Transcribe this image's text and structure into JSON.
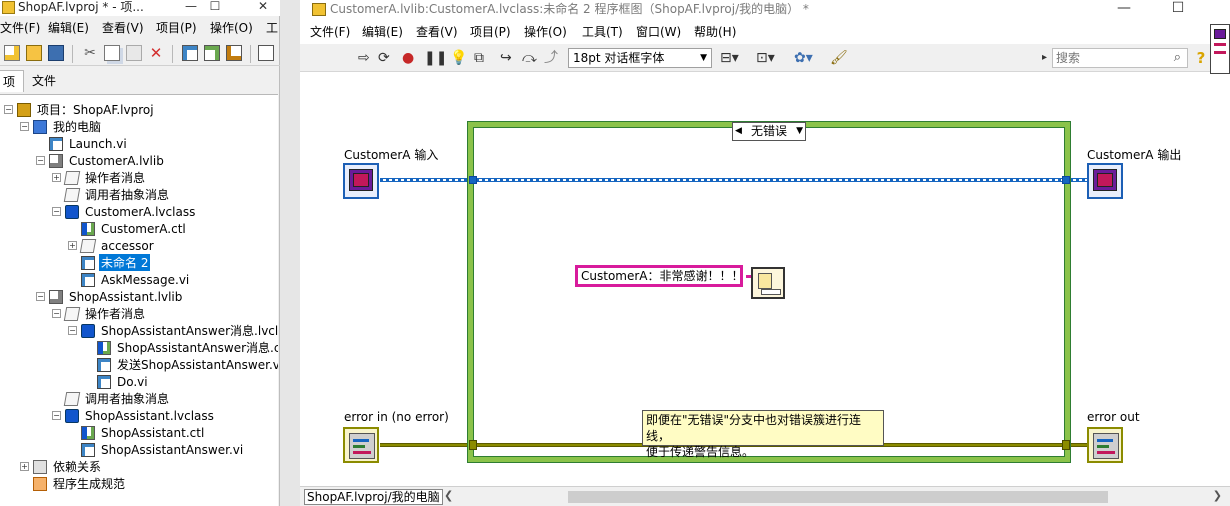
{
  "project_window": {
    "title": "ShopAF.lvproj * - 项...",
    "window_controls": {
      "minimize": "—",
      "maximize": "☐",
      "close": "✕"
    },
    "menu": [
      "文件(F)",
      "编辑(E)",
      "查看(V)",
      "项目(P)",
      "操作(O)",
      "工"
    ],
    "tabs": [
      "项",
      "文件"
    ],
    "tree": [
      {
        "label": "项目：ShopAF.lvproj",
        "icon": "project-icon",
        "level": 0,
        "toggle": "−"
      },
      {
        "label": "我的电脑",
        "icon": "computer-icon",
        "level": 1,
        "toggle": "−"
      },
      {
        "label": "Launch.vi",
        "icon": "vi-icon",
        "level": 2,
        "toggle": ""
      },
      {
        "label": "CustomerA.lvlib",
        "icon": "library-icon",
        "level": 2,
        "toggle": "−"
      },
      {
        "label": "操作者消息",
        "icon": "folder-icon",
        "level": 3,
        "toggle": "+"
      },
      {
        "label": "调用者抽象消息",
        "icon": "folder-icon",
        "level": 3,
        "toggle": ""
      },
      {
        "label": "CustomerA.lvclass",
        "icon": "class-icon",
        "level": 3,
        "toggle": "−"
      },
      {
        "label": "CustomerA.ctl",
        "icon": "control-icon",
        "level": 4,
        "toggle": ""
      },
      {
        "label": "accessor",
        "icon": "folder-icon",
        "level": 4,
        "toggle": "+"
      },
      {
        "label": "未命名 2",
        "icon": "vi-icon",
        "level": 4,
        "toggle": "",
        "selected": true
      },
      {
        "label": "AskMessage.vi",
        "icon": "vi-icon",
        "level": 4,
        "toggle": ""
      },
      {
        "label": "ShopAssistant.lvlib",
        "icon": "library-icon",
        "level": 2,
        "toggle": "−"
      },
      {
        "label": "操作者消息",
        "icon": "folder-icon",
        "level": 3,
        "toggle": "−"
      },
      {
        "label": "ShopAssistantAnswer消息.lvcl",
        "icon": "class-icon",
        "level": 4,
        "toggle": "−"
      },
      {
        "label": "ShopAssistantAnswer消息.c",
        "icon": "control-icon",
        "level": 5,
        "toggle": ""
      },
      {
        "label": "发送ShopAssistantAnswer.v",
        "icon": "vi-icon",
        "level": 5,
        "toggle": ""
      },
      {
        "label": "Do.vi",
        "icon": "vi-icon",
        "level": 5,
        "toggle": ""
      },
      {
        "label": "调用者抽象消息",
        "icon": "folder-icon",
        "level": 3,
        "toggle": ""
      },
      {
        "label": "ShopAssistant.lvclass",
        "icon": "class-icon",
        "level": 3,
        "toggle": "−"
      },
      {
        "label": "ShopAssistant.ctl",
        "icon": "control-icon",
        "level": 4,
        "toggle": ""
      },
      {
        "label": "ShopAssistantAnswer.vi",
        "icon": "vi-icon",
        "level": 4,
        "toggle": ""
      },
      {
        "label": "依赖关系",
        "icon": "dependencies-icon",
        "level": 1,
        "toggle": "+"
      },
      {
        "label": "程序生成规范",
        "icon": "build-spec-icon",
        "level": 1,
        "toggle": ""
      }
    ]
  },
  "diagram_window": {
    "title": "CustomerA.lvlib:CustomerA.lvclass:未命名 2 程序框图（ShopAF.lvproj/我的电脑） *",
    "window_controls": {
      "minimize": "—",
      "maximize": "☐"
    },
    "menu": [
      "文件(F)",
      "编辑(E)",
      "查看(V)",
      "项目(P)",
      "操作(O)",
      "工具(T)",
      "窗口(W)",
      "帮助(H)"
    ],
    "font_select": "18pt 对话框字体",
    "search_placeholder": "搜索",
    "case_selector": "无错误",
    "terminals": {
      "customer_in": "CustomerA 输入",
      "customer_out": "CustomerA 输出",
      "error_in": "error in (no error)",
      "error_out": "error out"
    },
    "string_constant": "CustomerA：非常感谢！！！",
    "comment_lines": [
      "即便在\"无错误\"分支中也对错误簇进行连线，",
      "便于传递警告信息。"
    ],
    "status_path": "ShopAF.lvproj/我的电脑"
  },
  "colors": {
    "case_border": "#8bc34a",
    "class_wire": "#1565c0",
    "error_wire": "#8b8b00",
    "string_border": "#d81b9c",
    "annotation_red": "#d9363e",
    "selection_blue": "#0078d7"
  }
}
